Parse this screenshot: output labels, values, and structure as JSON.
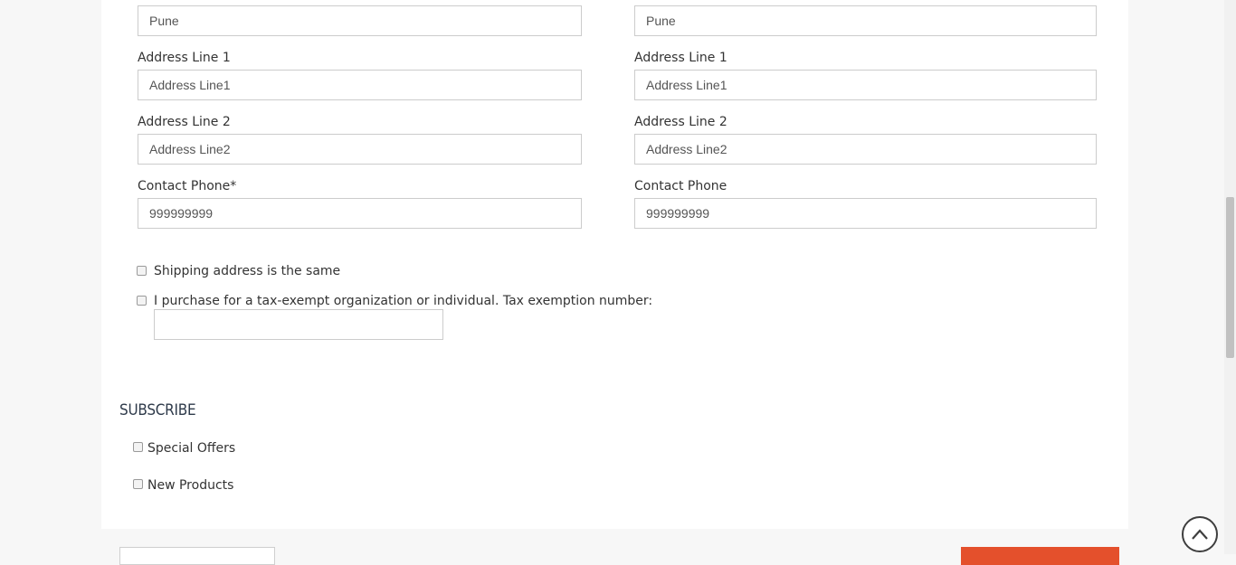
{
  "billing": {
    "city_value": "Pune",
    "address1_label": "Address Line 1",
    "address1_placeholder": "Address Line1",
    "address2_label": "Address Line 2",
    "address2_placeholder": "Address Line2",
    "phone_label": "Contact Phone*",
    "phone_placeholder": "999999999"
  },
  "shipping": {
    "city_value": "Pune",
    "address1_label": "Address Line 1",
    "address1_placeholder": "Address Line1",
    "address2_label": "Address Line 2",
    "address2_placeholder": "Address Line2",
    "phone_label": "Contact Phone",
    "phone_placeholder": "999999999"
  },
  "options": {
    "same_shipping_label": "Shipping address is the same",
    "tax_exempt_label": "I purchase for a tax-exempt organization or individual. Tax exemption number:",
    "tax_exempt_number": ""
  },
  "subscribe": {
    "title": "SUBSCRIBE",
    "special_offers_label": "Special Offers",
    "new_products_label": "New Products"
  },
  "icons": {
    "scroll_top": "chevron-up-circle-icon"
  },
  "colors": {
    "accent": "#e4502c",
    "title": "#2f3b4b"
  }
}
